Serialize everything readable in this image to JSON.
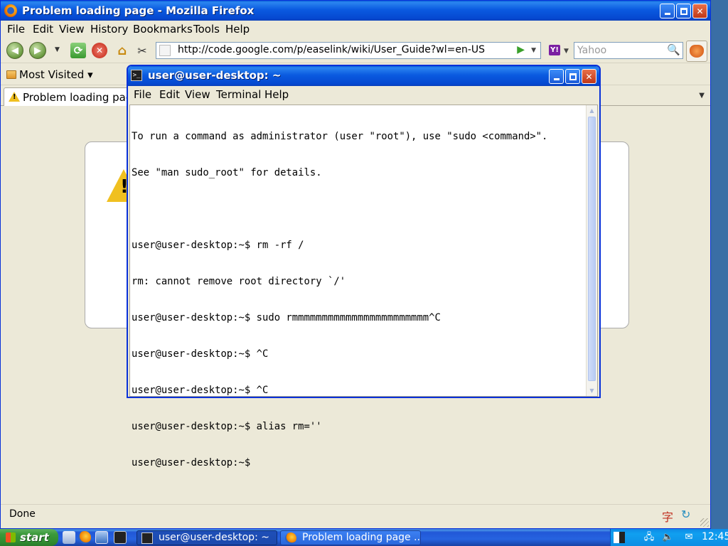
{
  "firefox": {
    "title": "Problem loading page - Mozilla Firefox",
    "menu": [
      "File",
      "Edit",
      "View",
      "History",
      "Bookmarks",
      "Tools",
      "Help"
    ],
    "url": "http://code.google.com/p/easelink/wiki/User_Guide?wl=en-US",
    "search_engine_icon": "yahoo-icon",
    "search_placeholder": "Yahoo",
    "bookmarks": {
      "most_visited": "Most Visited ▾"
    },
    "tab_title": "Problem loading page",
    "status": "Done",
    "status_char": "字"
  },
  "terminal": {
    "title": "user@user-desktop: ~",
    "menu": [
      "File",
      "Edit",
      "View",
      "Terminal",
      "Help"
    ],
    "lines": [
      "To run a command as administrator (user \"root\"), use \"sudo <command>\".",
      "See \"man sudo_root\" for details.",
      "",
      "user@user-desktop:~$ rm -rf /",
      "rm: cannot remove root directory `/'",
      "user@user-desktop:~$ sudo rmmmmmmmmmmmmmmmmmmmmmmm^C",
      "user@user-desktop:~$ ^C",
      "user@user-desktop:~$ ^C",
      "user@user-desktop:~$ alias rm=''",
      "user@user-desktop:~$"
    ]
  },
  "taskbar": {
    "start_label": "start",
    "tasks": [
      {
        "label": "user@user-desktop: ~",
        "icon": "terminal-icon",
        "active": true
      },
      {
        "label": "Problem loading page ...",
        "icon": "firefox-icon",
        "active": false
      }
    ],
    "clock": "12:45"
  }
}
